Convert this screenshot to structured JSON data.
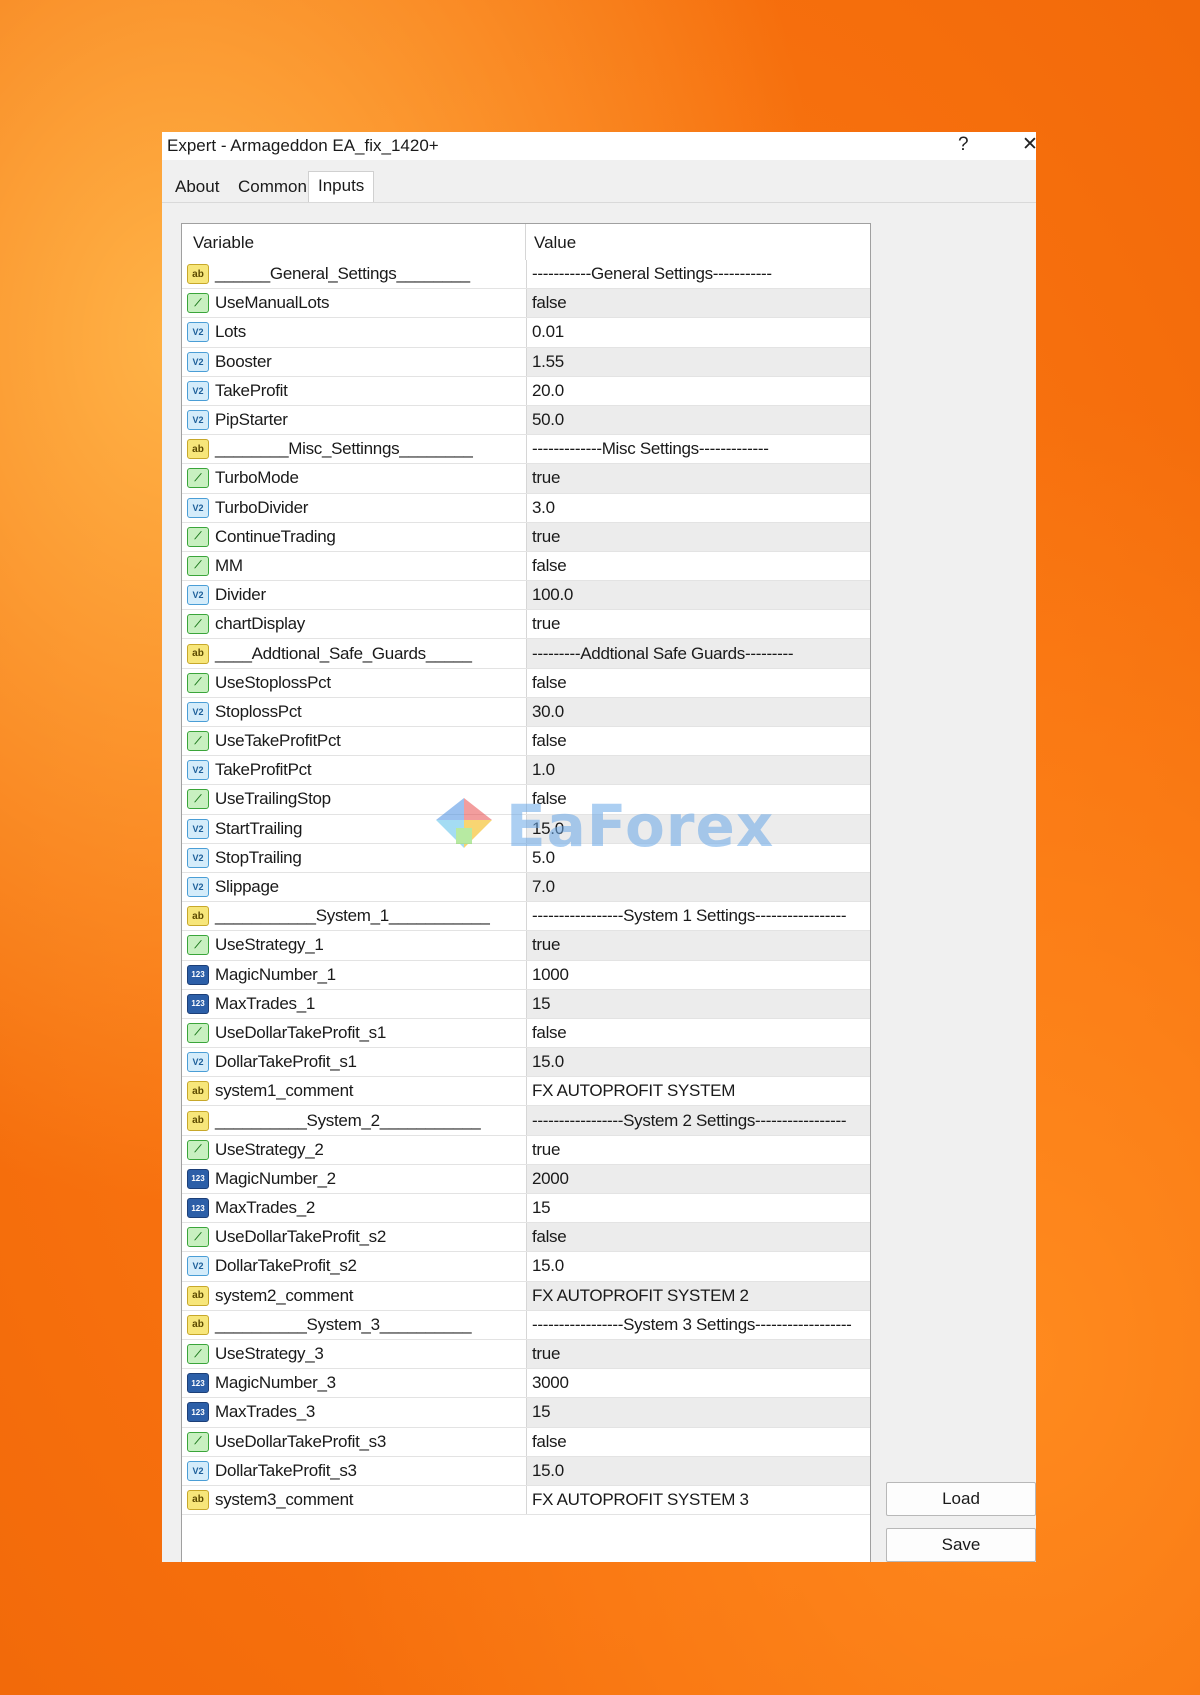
{
  "window": {
    "title": "Expert - Armageddon EA_fix_1420+",
    "help_label": "?",
    "close_label": "✕"
  },
  "tabs": [
    {
      "label": "About"
    },
    {
      "label": "Common"
    },
    {
      "label": "Inputs"
    }
  ],
  "active_tab": "Inputs",
  "table": {
    "columns": [
      "Variable",
      "Value"
    ],
    "rows": [
      {
        "icon": "ab",
        "variable": "______General_Settings________",
        "value": "-----------General Settings-----------"
      },
      {
        "icon": "bool",
        "variable": "UseManualLots",
        "value": "false"
      },
      {
        "icon": "double",
        "variable": "Lots",
        "value": "0.01"
      },
      {
        "icon": "double",
        "variable": "Booster",
        "value": "1.55"
      },
      {
        "icon": "double",
        "variable": "TakeProfit",
        "value": "20.0"
      },
      {
        "icon": "double",
        "variable": "PipStarter",
        "value": "50.0"
      },
      {
        "icon": "ab",
        "variable": "________Misc_Settinngs________",
        "value": "-------------Misc Settings-------------"
      },
      {
        "icon": "bool",
        "variable": "TurboMode",
        "value": "true"
      },
      {
        "icon": "double",
        "variable": "TurboDivider",
        "value": "3.0"
      },
      {
        "icon": "bool",
        "variable": "ContinueTrading",
        "value": "true"
      },
      {
        "icon": "bool",
        "variable": "MM",
        "value": "false"
      },
      {
        "icon": "double",
        "variable": "Divider",
        "value": "100.0"
      },
      {
        "icon": "bool",
        "variable": "chartDisplay",
        "value": "true"
      },
      {
        "icon": "ab",
        "variable": "____Addtional_Safe_Guards_____",
        "value": "---------Addtional Safe Guards---------"
      },
      {
        "icon": "bool",
        "variable": "UseStoplossPct",
        "value": "false"
      },
      {
        "icon": "double",
        "variable": "StoplossPct",
        "value": "30.0"
      },
      {
        "icon": "bool",
        "variable": "UseTakeProfitPct",
        "value": "false"
      },
      {
        "icon": "double",
        "variable": "TakeProfitPct",
        "value": "1.0"
      },
      {
        "icon": "bool",
        "variable": "UseTrailingStop",
        "value": "false"
      },
      {
        "icon": "double",
        "variable": "StartTrailing",
        "value": "15.0"
      },
      {
        "icon": "double",
        "variable": "StopTrailing",
        "value": "5.0"
      },
      {
        "icon": "double",
        "variable": "Slippage",
        "value": "7.0"
      },
      {
        "icon": "ab",
        "variable": "___________System_1___________",
        "value": "-----------------System 1 Settings-----------------"
      },
      {
        "icon": "bool",
        "variable": "UseStrategy_1",
        "value": "true"
      },
      {
        "icon": "int",
        "variable": "MagicNumber_1",
        "value": "1000"
      },
      {
        "icon": "int",
        "variable": "MaxTrades_1",
        "value": "15"
      },
      {
        "icon": "bool",
        "variable": "UseDollarTakeProfit_s1",
        "value": "false"
      },
      {
        "icon": "double",
        "variable": "DollarTakeProfit_s1",
        "value": "15.0"
      },
      {
        "icon": "ab",
        "variable": "system1_comment",
        "value": "FX AUTOPROFIT SYSTEM"
      },
      {
        "icon": "ab",
        "variable": "__________System_2___________",
        "value": "-----------------System 2 Settings-----------------"
      },
      {
        "icon": "bool",
        "variable": "UseStrategy_2",
        "value": "true"
      },
      {
        "icon": "int",
        "variable": "MagicNumber_2",
        "value": "2000"
      },
      {
        "icon": "int",
        "variable": "MaxTrades_2",
        "value": "15"
      },
      {
        "icon": "bool",
        "variable": "UseDollarTakeProfit_s2",
        "value": "false"
      },
      {
        "icon": "double",
        "variable": "DollarTakeProfit_s2",
        "value": "15.0"
      },
      {
        "icon": "ab",
        "variable": "system2_comment",
        "value": "FX AUTOPROFIT SYSTEM 2"
      },
      {
        "icon": "ab",
        "variable": "__________System_3__________",
        "value": "-----------------System 3 Settings------------------"
      },
      {
        "icon": "bool",
        "variable": "UseStrategy_3",
        "value": "true"
      },
      {
        "icon": "int",
        "variable": "MagicNumber_3",
        "value": "3000"
      },
      {
        "icon": "int",
        "variable": "MaxTrades_3",
        "value": "15"
      },
      {
        "icon": "bool",
        "variable": "UseDollarTakeProfit_s3",
        "value": "false"
      },
      {
        "icon": "double",
        "variable": "DollarTakeProfit_s3",
        "value": "15.0"
      },
      {
        "icon": "ab",
        "variable": "system3_comment",
        "value": "FX AUTOPROFIT SYSTEM 3"
      }
    ]
  },
  "buttons": {
    "load_label": "Load",
    "save_label": "Save"
  },
  "icon_labels": {
    "ab": "ab",
    "bool": "⟋",
    "double": "V2",
    "int": "123"
  },
  "watermark": {
    "text": "EaForex"
  },
  "colors": {
    "background": "#f26a0a",
    "ab_icon": "#f7e67a",
    "bool_icon": "#c8f0c0",
    "double_icon": "#d4ecfa",
    "int_icon": "#2c5fa8",
    "watermark": "#6aa8e8"
  }
}
